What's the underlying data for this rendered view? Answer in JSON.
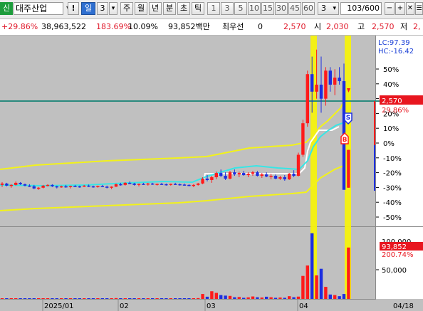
{
  "toolbar": {
    "code_badge": "신",
    "stock_name": "대주산업",
    "alert_icon": "!",
    "day_button": "일",
    "period_value": "3",
    "dropdown_arrow": "▾",
    "week_button": "주",
    "month_button": "월",
    "year_button": "년",
    "minute_button": "분",
    "second_button": "초",
    "tick_button": "틱",
    "intervals": [
      "1",
      "3",
      "5",
      "10",
      "15",
      "30",
      "45",
      "60"
    ],
    "interval_select": "3",
    "zoom_value": "103/600",
    "icons": [
      "zoom-out-icon",
      "zoom-in-icon",
      "reset-icon",
      "menu-icon"
    ]
  },
  "info": {
    "change_rate": "+29.86%",
    "volume": "38,963,522",
    "volume_ratio": "183.69%",
    "turnover": "10.09%",
    "amount": "93,852백만",
    "pref_label": "최우선",
    "pref_value": "0",
    "price": "2,570",
    "open_label": "시",
    "open_value": "2,030",
    "high_label": "고",
    "high_value": "2,570",
    "low_label": "저",
    "low_value": "2,"
  },
  "price_panel": {
    "lc_label": "LC:97.39",
    "hc_label": "HC:-16.42",
    "current_price_badge": "2,570",
    "current_rate_badge": "29.86%",
    "pct_ticks": [
      "50%",
      "40%",
      "30%",
      "20%",
      "10%",
      "0%",
      "-10%",
      "-20%",
      "-30%",
      "-40%",
      "-50%"
    ],
    "signal_sell": "S",
    "signal_buy": "B",
    "colors": {
      "up": "#ff1a1a",
      "down": "#1c2ee0",
      "envelope": "#f2f21a",
      "baseline": "#2a8a7e",
      "ma": "#37e6e6"
    }
  },
  "volume_panel": {
    "volume_badge": "93,852",
    "volume_rate_badge": "200.74%",
    "ticks": [
      "100,000",
      "50,000"
    ]
  },
  "x_axis": {
    "labels": [
      "2025/01",
      "02",
      "03",
      "04",
      "04/18"
    ]
  },
  "candles": [
    [
      1,
      2070,
      2110,
      2040,
      2090
    ],
    [
      2,
      2090,
      2100,
      2050,
      2060
    ],
    [
      3,
      2060,
      2080,
      2030,
      2070
    ],
    [
      4,
      2070,
      2120,
      2060,
      2100
    ],
    [
      5,
      2100,
      2110,
      2070,
      2080
    ],
    [
      6,
      2080,
      2090,
      2050,
      2060
    ],
    [
      7,
      2060,
      2080,
      2040,
      2050
    ],
    [
      8,
      2050,
      2070,
      2010,
      2020
    ],
    [
      9,
      2020,
      2040,
      2000,
      2030
    ],
    [
      10,
      2030,
      2070,
      2020,
      2060
    ],
    [
      11,
      2060,
      2080,
      2050,
      2070
    ],
    [
      12,
      2070,
      2080,
      2040,
      2050
    ],
    [
      13,
      2050,
      2060,
      2020,
      2040
    ],
    [
      14,
      2040,
      2060,
      2030,
      2050
    ],
    [
      15,
      2050,
      2070,
      2030,
      2040
    ],
    [
      16,
      2040,
      2060,
      2020,
      2055
    ],
    [
      17,
      2055,
      2070,
      2040,
      2050
    ],
    [
      18,
      2050,
      2060,
      2030,
      2045
    ],
    [
      19,
      2045,
      2070,
      2040,
      2060
    ],
    [
      20,
      2060,
      2075,
      2040,
      2050
    ],
    [
      21,
      2050,
      2060,
      2030,
      2040
    ],
    [
      22,
      2040,
      2060,
      2030,
      2055
    ],
    [
      23,
      2055,
      2070,
      2040,
      2045
    ],
    [
      24,
      2045,
      2060,
      2020,
      2030
    ],
    [
      25,
      2030,
      2050,
      2010,
      2045
    ],
    [
      26,
      2045,
      2090,
      2040,
      2080
    ],
    [
      27,
      2080,
      2100,
      2060,
      2070
    ],
    [
      28,
      2070,
      2110,
      2060,
      2100
    ],
    [
      29,
      2100,
      2120,
      2080,
      2090
    ],
    [
      30,
      2090,
      2100,
      2060,
      2070
    ],
    [
      31,
      2070,
      2090,
      2050,
      2085
    ],
    [
      32,
      2085,
      2100,
      2070,
      2080
    ],
    [
      33,
      2080,
      2100,
      2060,
      2090
    ],
    [
      34,
      2090,
      2100,
      2070,
      2075
    ],
    [
      35,
      2075,
      2090,
      2060,
      2085
    ],
    [
      36,
      2085,
      2100,
      2070,
      2080
    ],
    [
      37,
      2080,
      2090,
      2060,
      2070
    ],
    [
      38,
      2070,
      2090,
      2060,
      2085
    ],
    [
      39,
      2085,
      2100,
      2070,
      2080
    ],
    [
      40,
      2080,
      2090,
      2060,
      2075
    ],
    [
      41,
      2075,
      2090,
      2060,
      2070
    ],
    [
      42,
      2070,
      2080,
      2050,
      2060
    ],
    [
      43,
      2060,
      2080,
      2040,
      2070
    ],
    [
      44,
      2070,
      2100,
      2060,
      2090
    ],
    [
      45,
      2090,
      2180,
      2080,
      2160
    ],
    [
      46,
      2160,
      2210,
      2120,
      2140
    ],
    [
      47,
      2140,
      2200,
      2100,
      2180
    ],
    [
      48,
      2180,
      2260,
      2150,
      2240
    ],
    [
      49,
      2240,
      2290,
      2180,
      2200
    ],
    [
      50,
      2200,
      2250,
      2140,
      2160
    ],
    [
      51,
      2160,
      2270,
      2150,
      2250
    ],
    [
      52,
      2250,
      2290,
      2200,
      2220
    ],
    [
      53,
      2220,
      2260,
      2180,
      2240
    ],
    [
      54,
      2240,
      2270,
      2200,
      2210
    ],
    [
      55,
      2210,
      2250,
      2180,
      2230
    ],
    [
      56,
      2230,
      2270,
      2200,
      2250
    ],
    [
      57,
      2250,
      2270,
      2190,
      2200
    ],
    [
      58,
      2200,
      2240,
      2170,
      2220
    ],
    [
      59,
      2220,
      2250,
      2180,
      2190
    ],
    [
      60,
      2190,
      2230,
      2150,
      2200
    ],
    [
      61,
      2200,
      2220,
      2150,
      2160
    ],
    [
      62,
      2160,
      2200,
      2140,
      2180
    ],
    [
      63,
      2180,
      2210,
      2130,
      2150
    ],
    [
      64,
      2150,
      2240,
      2140,
      2230
    ],
    [
      65,
      2230,
      2280,
      2180,
      2200
    ],
    [
      66,
      2200,
      2530,
      2190,
      2500
    ],
    [
      67,
      2500,
      3000,
      2470,
      2950
    ],
    [
      68,
      2950,
      3700,
      2900,
      3650
    ],
    [
      69,
      3650,
      3900,
      3100,
      3400
    ],
    [
      70,
      3400,
      4000,
      3300,
      3500
    ],
    [
      71,
      3500,
      3900,
      3100,
      3300
    ],
    [
      72,
      3300,
      3750,
      3200,
      3700
    ],
    [
      73,
      3700,
      3750,
      3400,
      3500
    ],
    [
      74,
      3500,
      3720,
      3350,
      3600
    ],
    [
      75,
      3600,
      3750,
      3500,
      3550
    ],
    [
      76,
      3550,
      3800,
      2300,
      2000
    ],
    [
      77,
      2030,
      2570,
      2030,
      2570
    ]
  ],
  "volumes": [
    [
      1,
      1200
    ],
    [
      2,
      900
    ],
    [
      3,
      700
    ],
    [
      4,
      800
    ],
    [
      5,
      1100
    ],
    [
      6,
      900
    ],
    [
      7,
      700
    ],
    [
      8,
      600
    ],
    [
      9,
      900
    ],
    [
      10,
      800
    ],
    [
      11,
      700
    ],
    [
      12,
      800
    ],
    [
      13,
      900
    ],
    [
      14,
      600
    ],
    [
      15,
      700
    ],
    [
      16,
      800
    ],
    [
      17,
      700
    ],
    [
      18,
      900
    ],
    [
      19,
      600
    ],
    [
      20,
      700
    ],
    [
      21,
      800
    ],
    [
      22,
      600
    ],
    [
      23,
      700
    ],
    [
      24,
      900
    ],
    [
      25,
      800
    ],
    [
      26,
      1500
    ],
    [
      27,
      1100
    ],
    [
      28,
      900
    ],
    [
      29,
      800
    ],
    [
      30,
      1000
    ],
    [
      31,
      1200
    ],
    [
      32,
      900
    ],
    [
      33,
      800
    ],
    [
      34,
      700
    ],
    [
      35,
      600
    ],
    [
      36,
      1100
    ],
    [
      37,
      700
    ],
    [
      38,
      600
    ],
    [
      39,
      900
    ],
    [
      40,
      800
    ],
    [
      41,
      700
    ],
    [
      42,
      700
    ],
    [
      43,
      1200
    ],
    [
      44,
      1500
    ],
    [
      45,
      9000
    ],
    [
      46,
      4000
    ],
    [
      47,
      14000
    ],
    [
      48,
      11000
    ],
    [
      49,
      7000
    ],
    [
      50,
      6000
    ],
    [
      51,
      5500
    ],
    [
      52,
      3000
    ],
    [
      53,
      3500
    ],
    [
      54,
      2000
    ],
    [
      55,
      2800
    ],
    [
      56,
      4500
    ],
    [
      57,
      3000
    ],
    [
      58,
      2500
    ],
    [
      59,
      4000
    ],
    [
      60,
      3000
    ],
    [
      61,
      2000
    ],
    [
      62,
      2500
    ],
    [
      63,
      2000
    ],
    [
      64,
      5000
    ],
    [
      65,
      3000
    ],
    [
      66,
      4200
    ],
    [
      67,
      42000
    ],
    [
      68,
      61000
    ],
    [
      69,
      120000
    ],
    [
      70,
      43000
    ],
    [
      71,
      55000
    ],
    [
      72,
      22000
    ],
    [
      73,
      8000
    ],
    [
      74,
      7000
    ],
    [
      75,
      5000
    ],
    [
      76,
      9000
    ],
    [
      77,
      93852
    ]
  ]
}
